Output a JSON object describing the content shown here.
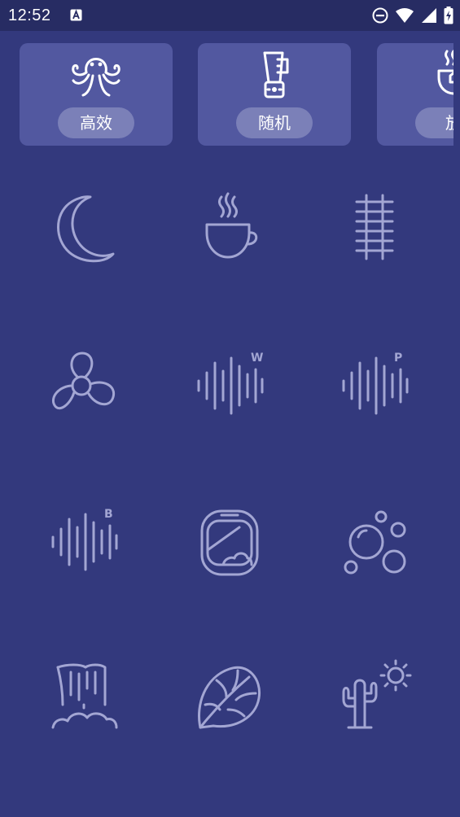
{
  "status_bar": {
    "time": "12:52",
    "icons": [
      "a-notification-icon",
      "do-not-disturb-icon",
      "wifi-icon",
      "cell-signal-icon",
      "battery-charging-icon"
    ]
  },
  "modes": [
    {
      "label": "高效",
      "icon": "octopus-icon"
    },
    {
      "label": "随机",
      "icon": "blender-icon"
    },
    {
      "label": "放",
      "icon": "tea-cup-icon"
    }
  ],
  "sounds": [
    {
      "icon": "moon-icon"
    },
    {
      "icon": "coffee-cup-icon"
    },
    {
      "icon": "railway-track-icon"
    },
    {
      "icon": "fan-icon"
    },
    {
      "icon": "white-noise-icon",
      "badge": "W"
    },
    {
      "icon": "pink-noise-icon",
      "badge": "P"
    },
    {
      "icon": "brown-noise-icon",
      "badge": "B"
    },
    {
      "icon": "airplane-window-icon"
    },
    {
      "icon": "bubbles-icon"
    },
    {
      "icon": "waterfall-icon"
    },
    {
      "icon": "monstera-leaf-icon"
    },
    {
      "icon": "cactus-sun-icon"
    }
  ],
  "colors": {
    "background": "#33397d",
    "status_bar": "#272c63",
    "card": "#5258a0",
    "pill": "#7b80b8",
    "icon_stroke": "#a3a6d3"
  }
}
